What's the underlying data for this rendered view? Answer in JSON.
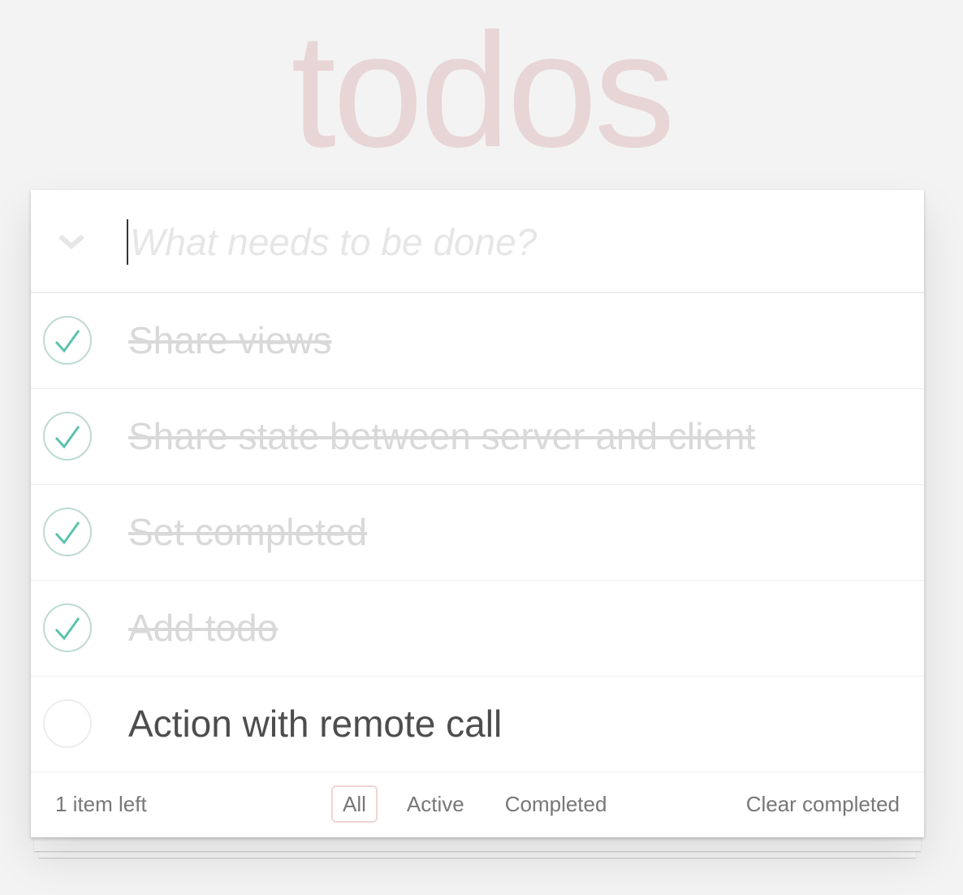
{
  "app": {
    "title": "todos",
    "accent_color": "#af2f2f",
    "check_color": "#5dc2af"
  },
  "header": {
    "toggle_all_icon": "chevron-down-icon",
    "new_todo_placeholder": "What needs to be done?",
    "new_todo_value": ""
  },
  "todos": [
    {
      "label": "Share views",
      "completed": true
    },
    {
      "label": "Share state between server and client",
      "completed": true
    },
    {
      "label": "Set completed",
      "completed": true
    },
    {
      "label": "Add todo",
      "completed": true
    },
    {
      "label": "Action with remote call",
      "completed": false
    }
  ],
  "footer": {
    "count_text": "1 item left",
    "filters": [
      {
        "label": "All",
        "selected": true
      },
      {
        "label": "Active",
        "selected": false
      },
      {
        "label": "Completed",
        "selected": false
      }
    ],
    "clear_completed_label": "Clear completed"
  }
}
